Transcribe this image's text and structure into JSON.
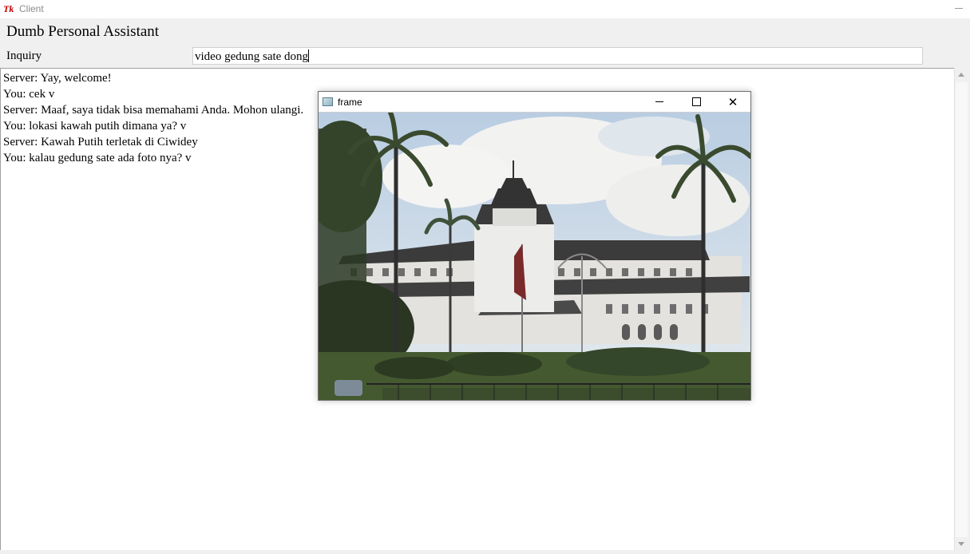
{
  "window": {
    "logo": "Tk",
    "title": "Client"
  },
  "app": {
    "title": "Dumb Personal Assistant",
    "inquiry_label": "Inquiry",
    "inquiry_value": "video gedung sate dong"
  },
  "chat": {
    "lines": [
      "Server: Yay, welcome!",
      "You: cek v",
      "Server: Maaf, saya tidak bisa memahami Anda. Mohon ulangi.",
      "You: lokasi kawah putih dimana ya? v",
      "Server: Kawah Putih terletak di Ciwidey",
      "You: kalau gedung sate ada foto nya? v"
    ]
  },
  "frame": {
    "title": "frame",
    "close_glyph": "✕"
  },
  "colors": {
    "sky": "#c9d8e8",
    "roof": "#3a3a3a",
    "building": "#e8e6e2",
    "foliage": "#2f3d26",
    "lawn": "#4f6b35"
  }
}
